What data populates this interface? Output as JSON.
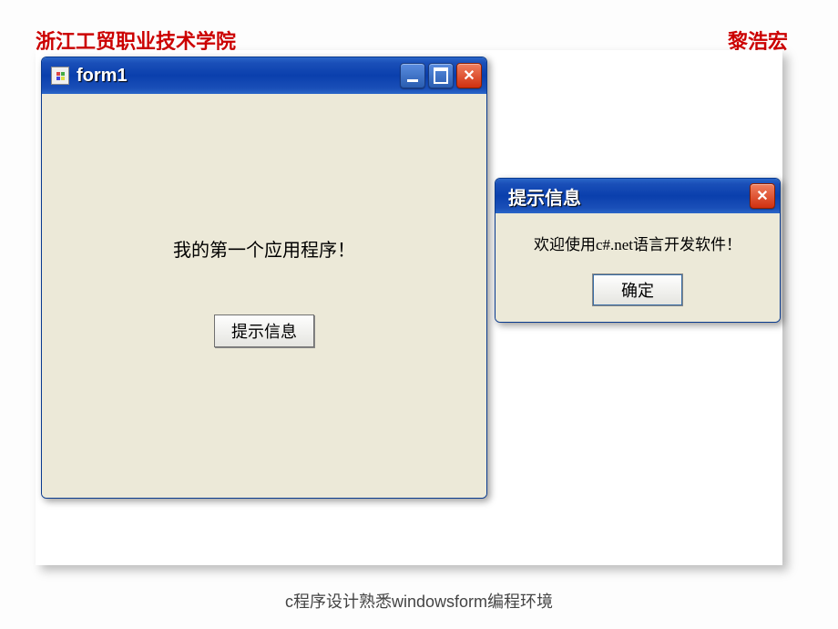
{
  "header": {
    "left": "浙江工贸职业技术学院",
    "right": "黎浩宏"
  },
  "window1": {
    "title": "form1",
    "label": "我的第一个应用程序！",
    "button": "提示信息"
  },
  "dialog": {
    "title": "提示信息",
    "message": "欢迎使用c#.net语言开发软件！",
    "ok": "确定"
  },
  "footer": "c程序设计熟悉windowsform编程环境"
}
